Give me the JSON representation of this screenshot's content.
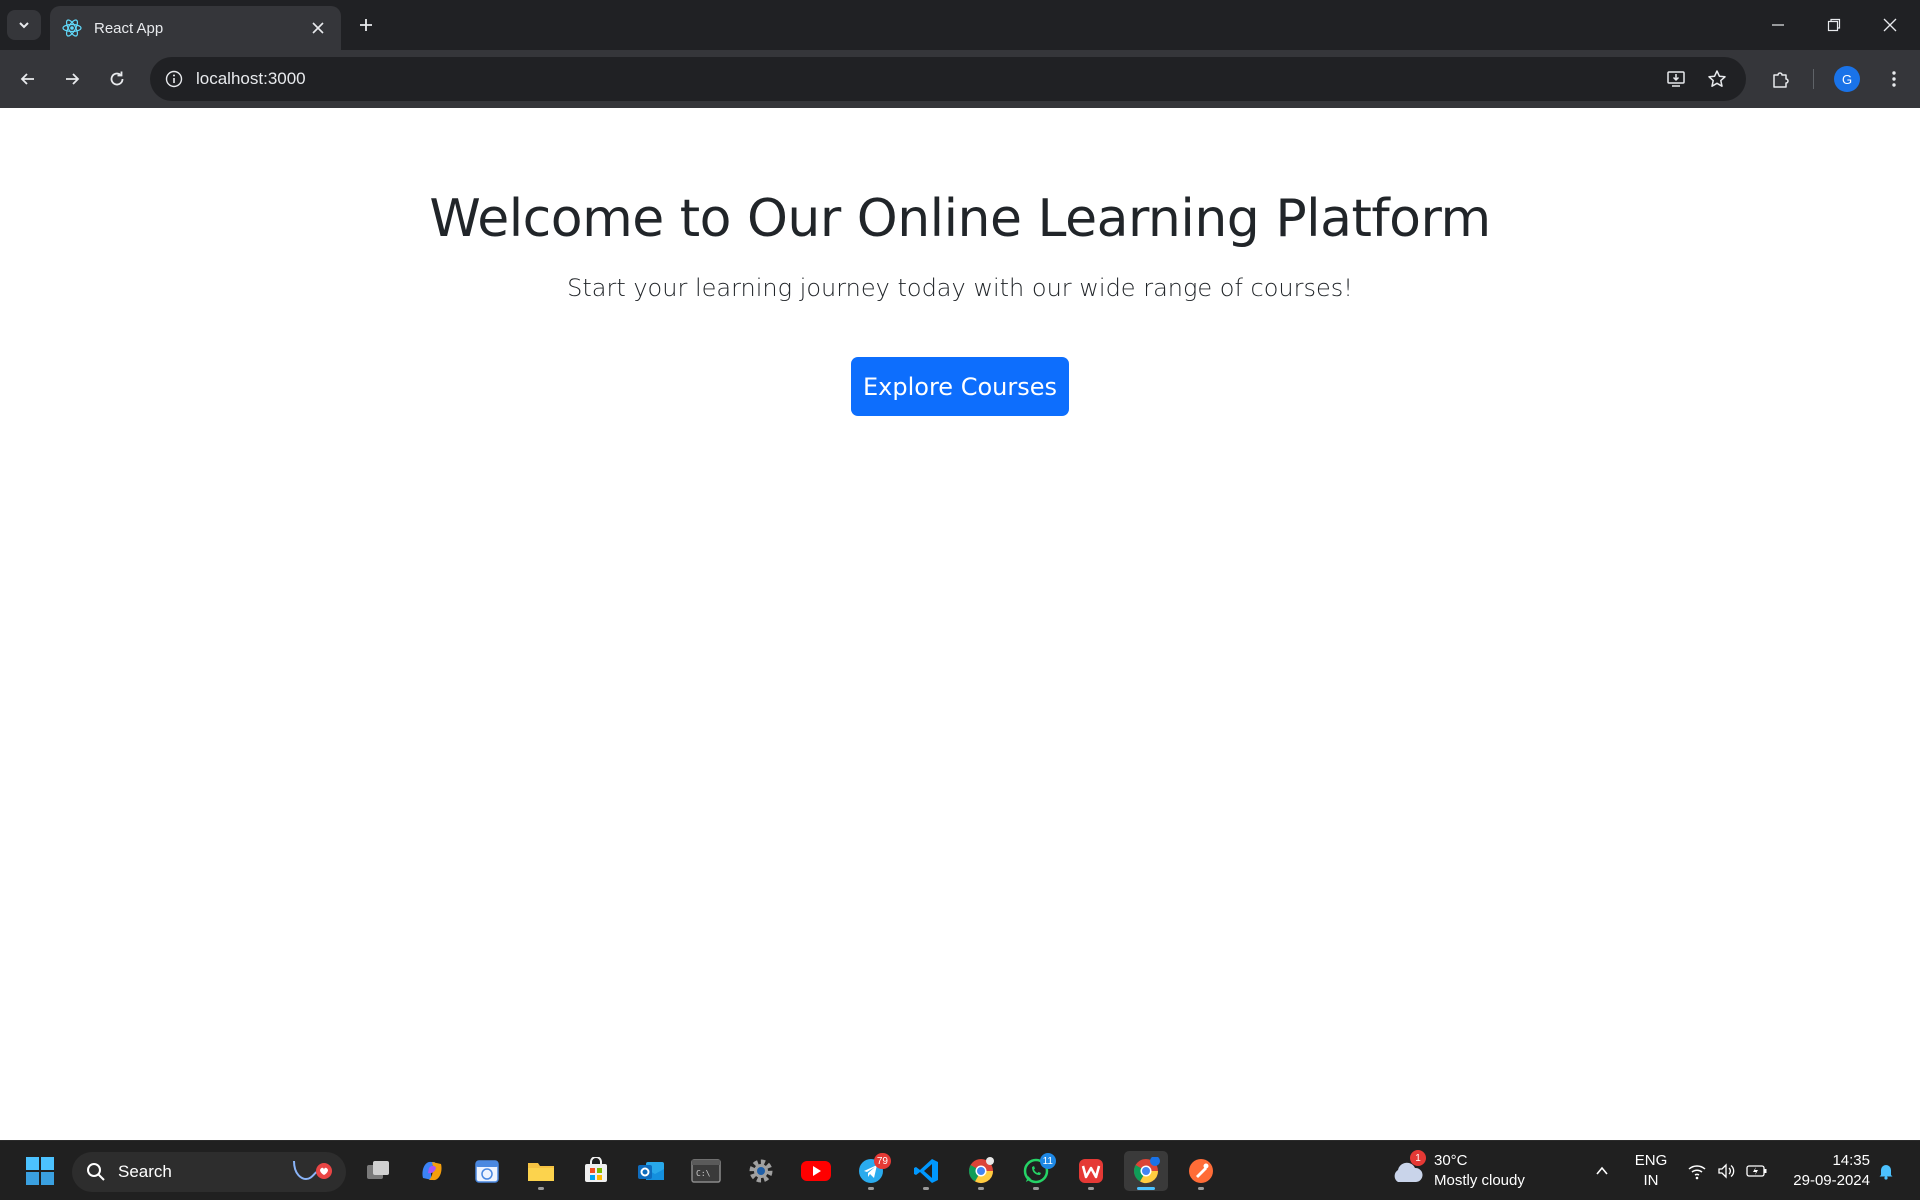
{
  "browser": {
    "tab_title": "React App",
    "url": "localhost:3000",
    "profile_initial": "G"
  },
  "page": {
    "title": "Welcome to Our Online Learning Platform",
    "subtitle": "Start your learning journey today with our wide range of courses!",
    "cta_label": "Explore Courses",
    "cta_color": "#0d6efd"
  },
  "taskbar": {
    "search_label": "Search",
    "weather_badge": "1",
    "weather_temp": "30°C",
    "weather_desc": "Mostly cloudy",
    "lang_line1": "ENG",
    "lang_line2": "IN",
    "time": "14:35",
    "date": "29-09-2024",
    "telegram_badge": "79",
    "whatsapp_badge": "11",
    "apps": [
      "start-icon",
      "search-icon",
      "task-view-icon",
      "copilot-icon",
      "calendar-app-icon",
      "file-explorer-icon",
      "store-icon",
      "outlook-icon",
      "terminal-icon",
      "settings-icon",
      "youtube-icon",
      "telegram-icon",
      "vscode-icon",
      "chrome-icon",
      "whatsapp-icon",
      "wps-office-icon",
      "chrome-profile-icon",
      "postman-icon"
    ]
  }
}
